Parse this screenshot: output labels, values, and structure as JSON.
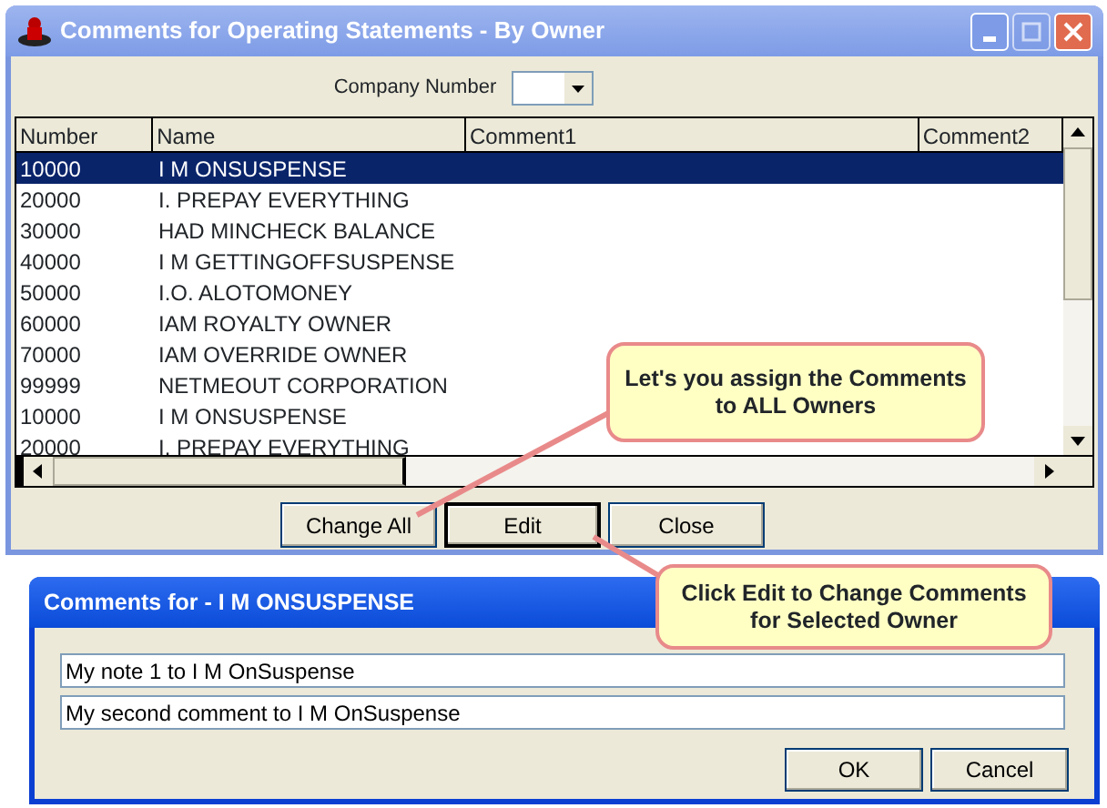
{
  "main_window": {
    "title": "Comments for Operating Statements - By Owner",
    "company_number": {
      "label": "Company Number"
    },
    "table": {
      "columns": [
        "Number",
        "Name",
        "Comment1",
        "Comment2"
      ],
      "rows": [
        {
          "number": "10000",
          "name": "I M ONSUSPENSE",
          "selected": true
        },
        {
          "number": "20000",
          "name": "I. PREPAY EVERYTHING",
          "selected": false
        },
        {
          "number": "30000",
          "name": "HAD MINCHECK BALANCE",
          "selected": false
        },
        {
          "number": "40000",
          "name": "I M GETTINGOFFSUSPENSE",
          "selected": false
        },
        {
          "number": "50000",
          "name": "I.O. ALOTOMONEY",
          "selected": false
        },
        {
          "number": "60000",
          "name": "IAM ROYALTY OWNER",
          "selected": false
        },
        {
          "number": "70000",
          "name": "IAM OVERRIDE OWNER",
          "selected": false
        },
        {
          "number": "99999",
          "name": "NETMEOUT CORPORATION",
          "selected": false
        },
        {
          "number": "10000",
          "name": "I M ONSUSPENSE",
          "selected": false
        },
        {
          "number": "20000",
          "name": "I. PREPAY EVERYTHING",
          "selected": false
        }
      ]
    },
    "buttons": [
      {
        "label": "Change All",
        "focused": false
      },
      {
        "label": "Edit",
        "focused": true
      },
      {
        "label": "Close",
        "focused": false
      }
    ]
  },
  "edit_dialog": {
    "title": "Comments for - I M ONSUSPENSE",
    "fields": [
      "My note 1 to I M OnSuspense",
      "My second comment to I M OnSuspense"
    ],
    "buttons": [
      "OK",
      "Cancel"
    ]
  },
  "callouts": [
    "Let's you assign the Comments to ALL Owners",
    "Click Edit to Change Comments for Selected Owner"
  ]
}
